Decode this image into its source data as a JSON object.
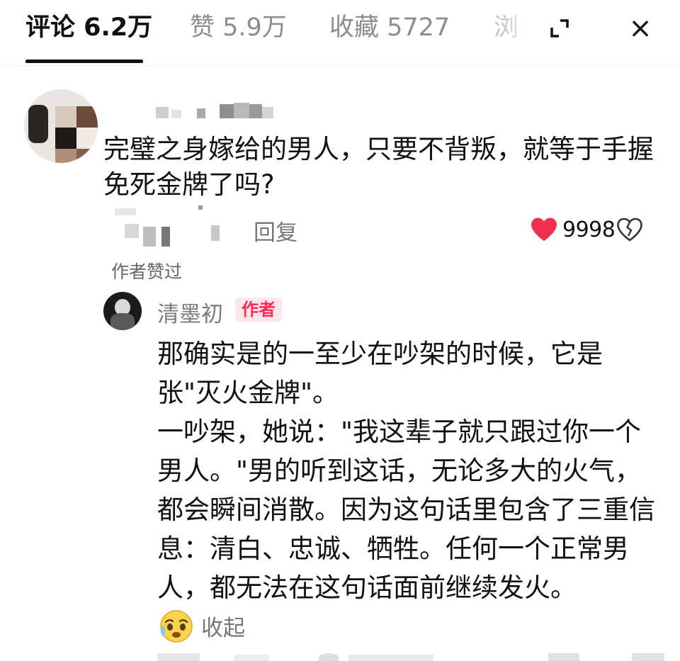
{
  "tabs": [
    {
      "label": "评论 6.2万",
      "active": true
    },
    {
      "label": "赞 5.9万",
      "active": false
    },
    {
      "label": "收藏 5727",
      "active": false
    },
    {
      "label": "浏",
      "active": false
    }
  ],
  "toolbar": {
    "expand_icon": "expand-corner-icon",
    "close_icon": "close-icon",
    "close_glyph": "×"
  },
  "comment": {
    "text": "完璧之身嫁给的男人，只要不背叛，就等于手握免死金牌了吗?",
    "reply_label": "回复",
    "like_count": "9998",
    "liked": true,
    "author_liked_label": "作者赞过"
  },
  "reply": {
    "author_name": "清墨初",
    "author_badge": "作者",
    "paragraphs": [
      "那确实是的一至少在吵架的时候，它是张\"灭火金牌\"。",
      "一吵架，她说：\"我这辈子就只跟过你一个男人。\"男的听到这话，无论多大的火气，都会瞬间消散。因为这句话里包含了三重信息：清白、忠诚、牺牲。任何一个正常男人，都无法在这句话面前继续发火。"
    ],
    "collapse_label": "收起"
  },
  "colors": {
    "accent": "#fe2c55",
    "heart": "#f0304f",
    "muted": "#777777",
    "badge_bg": "#fde6ea"
  }
}
